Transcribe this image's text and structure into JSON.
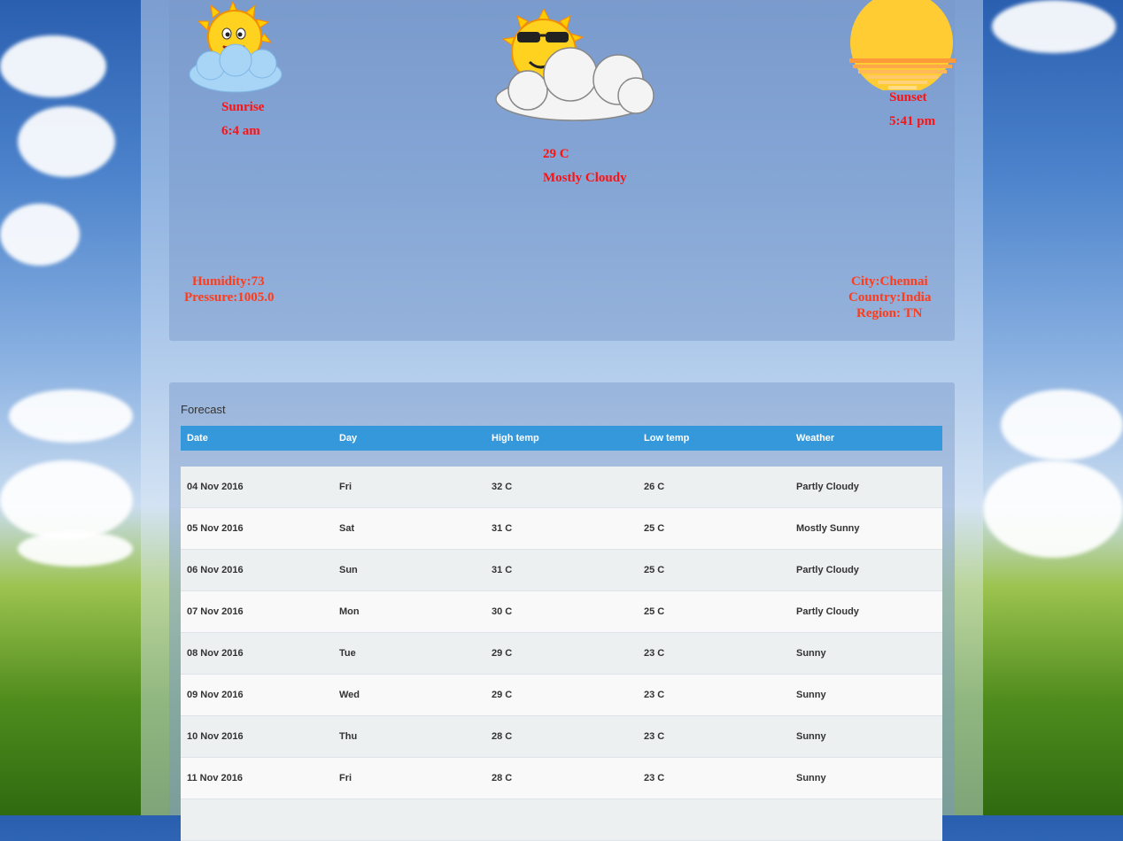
{
  "current": {
    "sunrise_label": "Sunrise",
    "sunrise_time": "6:4 am",
    "temperature": "29 C",
    "condition": "Mostly Cloudy",
    "sunset_label": "Sunset",
    "sunset_time": "5:41 pm",
    "humidity": "Humidity:73",
    "pressure": "Pressure:1005.0",
    "city": "City:Chennai",
    "country": "Country:India",
    "region": "Region: TN"
  },
  "forecast": {
    "title": "Forecast",
    "headers": [
      "Date",
      "Day",
      "High temp",
      "Low temp",
      "Weather"
    ],
    "rows": [
      [
        "04 Nov 2016",
        "Fri",
        "32 C",
        "26 C",
        "Partly Cloudy"
      ],
      [
        "05 Nov 2016",
        "Sat",
        "31 C",
        "25 C",
        "Mostly Sunny"
      ],
      [
        "06 Nov 2016",
        "Sun",
        "31 C",
        "25 C",
        "Partly Cloudy"
      ],
      [
        "07 Nov 2016",
        "Mon",
        "30 C",
        "25 C",
        "Partly Cloudy"
      ],
      [
        "08 Nov 2016",
        "Tue",
        "29 C",
        "23 C",
        "Sunny"
      ],
      [
        "09 Nov 2016",
        "Wed",
        "29 C",
        "23 C",
        "Sunny"
      ],
      [
        "10 Nov 2016",
        "Thu",
        "28 C",
        "23 C",
        "Sunny"
      ],
      [
        "11 Nov 2016",
        "Fri",
        "28 C",
        "23 C",
        "Sunny"
      ],
      [
        "",
        "",
        "",
        "",
        ""
      ]
    ]
  },
  "icons": {
    "sunrise": "smiling-sun-cloud-icon",
    "current": "sun-sunglasses-cloud-icon",
    "sunset": "setting-sun-icon"
  }
}
